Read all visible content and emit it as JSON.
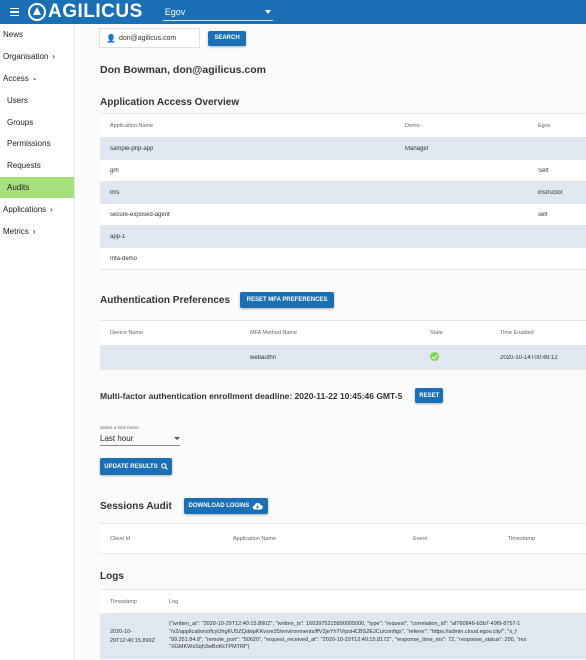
{
  "app": {
    "logo_text": "AGILICUS",
    "org_selected": "Egov",
    "icons": [
      "menu-icon",
      "logo-icon",
      "chevron-down-icon"
    ]
  },
  "sidebar": {
    "items": [
      {
        "label": "News"
      },
      {
        "label": "Organisation"
      },
      {
        "label": "Access"
      },
      {
        "label": "Users"
      },
      {
        "label": "Groups"
      },
      {
        "label": "Permissions"
      },
      {
        "label": "Requests"
      },
      {
        "label": "Audits"
      },
      {
        "label": "Applications"
      },
      {
        "label": "Metrics"
      }
    ],
    "active_color": "#a6e07a"
  },
  "search": {
    "value": "don@agilicus.com",
    "button_label": "SEARCH"
  },
  "user": {
    "heading": "Don Bowman, don@agilicus.com"
  },
  "access_overview": {
    "title": "Application Access Overview",
    "columns": [
      "Application Name",
      "Demo",
      "Egov"
    ],
    "rows": [
      {
        "app": "sample-php-app",
        "demo": "Manager",
        "egov": ""
      },
      {
        "app": "grh",
        "demo": "",
        "egov": "Self"
      },
      {
        "app": "lms",
        "demo": "",
        "egov": "instructor"
      },
      {
        "app": "secure-exposed-agent",
        "demo": "",
        "egov": "self"
      },
      {
        "app": "app-1",
        "demo": "",
        "egov": ""
      },
      {
        "app": "mfa-demo",
        "demo": "",
        "egov": ""
      }
    ]
  },
  "auth_prefs": {
    "title": "Authentication Preferences",
    "reset_button": "RESET MFA PREFERENCES",
    "columns": [
      "Device Name",
      "MFA Method Name",
      "State",
      "Time Enabled"
    ],
    "rows": [
      {
        "device": "",
        "method": "webauthn",
        "state": "check-circle-icon",
        "time": "2020-10-14T00:49:12"
      }
    ]
  },
  "mfa": {
    "deadline_text": "Multi-factor authentication enrollment deadline: 2020-11-22 10:45:46 GMT-5",
    "reset_button": "RESET"
  },
  "time_frame": {
    "label": "Select a time frame",
    "selected": "Last hour",
    "update_button": "UPDATE RESULTS"
  },
  "sessions": {
    "title": "Sessions Audit",
    "download_button": "DOWNLOAD LOGINS",
    "columns": [
      "Client Id",
      "Application Name",
      "Event",
      "Timestamp"
    ]
  },
  "logs": {
    "title": "Logs",
    "columns": [
      "Timestamp",
      "Log"
    ],
    "rows": [
      {
        "timestamp": "2020-10-\n29T12:40:15.890Z",
        "log": "{\"written_at\": \"2020-10-29T12:40:15.890Z\", \"written_ts\": 1603975215890005000, \"type\": \"request\", \"correlation_id\": \"af760846-b3b7-49f9-8757-1\n\"/v2/applications/fcyUhgKU5ZQdwpKKvsre35/environments/ffV2jeYhTVrpsHCBS2EJCu/configs\", \"referer\": \"https://admin.cloud.egov.city/\", \"x_f\n\"99.251.84.8\", \"remote_port\": \"50620\", \"request_received_at\": \"2020-10-29T12:40:15.817Z\", \"response_time_ms\": 72, \"response_status\": 200, \"res\n\"XGMKWsSqh3wBoKkTPMTRf\"}"
      }
    ]
  },
  "colors": {
    "primary": "#1a6fb5",
    "active": "#a6e07a",
    "row_highlight": "#dfe7f1",
    "success": "#7ed957"
  }
}
